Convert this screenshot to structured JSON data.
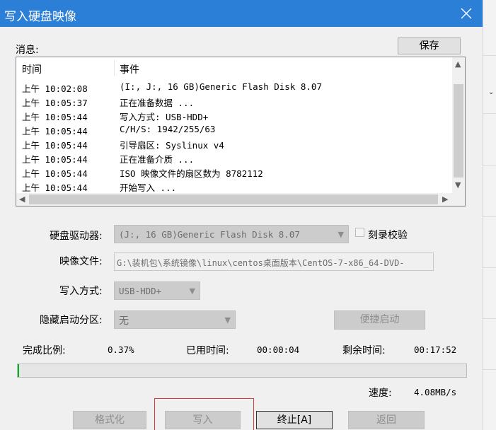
{
  "window": {
    "title": "写入硬盘映像"
  },
  "messages": {
    "label": "消息:",
    "save_button": "保存",
    "columns": [
      "时间",
      "事件"
    ],
    "rows": [
      {
        "time": "上午 10:02:08",
        "event": "(I:, J:, 16 GB)Generic Flash Disk       8.07"
      },
      {
        "time": "上午 10:05:37",
        "event": "正在准备数据 ..."
      },
      {
        "time": "上午 10:05:44",
        "event": "写入方式: USB-HDD+"
      },
      {
        "time": "上午 10:05:44",
        "event": "C/H/S: 1942/255/63"
      },
      {
        "time": "上午 10:05:44",
        "event": "引导扇区: Syslinux v4"
      },
      {
        "time": "上午 10:05:44",
        "event": "正在准备介质 ..."
      },
      {
        "time": "上午 10:05:44",
        "event": "ISO 映像文件的扇区数为 8782112"
      },
      {
        "time": "上午 10:05:44",
        "event": "开始写入 ..."
      }
    ]
  },
  "form": {
    "drive_label": "硬盘驱动器:",
    "drive_value": "(J:, 16 GB)Generic Flash Disk      8.07",
    "verify_label": "刻录校验",
    "verify_checked": false,
    "image_label": "映像文件:",
    "image_value": "G:\\装机包\\系统镜像\\linux\\centos桌面版本\\CentOS-7-x86_64-DVD-",
    "method_label": "写入方式:",
    "method_value": "USB-HDD+",
    "hidden_label": "隐藏启动分区:",
    "hidden_value": "无",
    "portable_button": "便捷启动"
  },
  "status": {
    "percent_label": "完成比例:",
    "percent_value": "0.37%",
    "elapsed_label": "已用时间:",
    "elapsed_value": "00:00:04",
    "remaining_label": "剩余时间:",
    "remaining_value": "00:17:52",
    "progress_fraction": 0.0037,
    "speed_label": "速度:",
    "speed_value": "4.08MB/s"
  },
  "buttons": {
    "format": "格式化",
    "write": "写入",
    "abort": "终止[A]",
    "back": "返回"
  },
  "colors": {
    "titlebar": "#2b7fd6",
    "progress_fill": "#06b025",
    "highlight_outline": "#e03a3a"
  }
}
